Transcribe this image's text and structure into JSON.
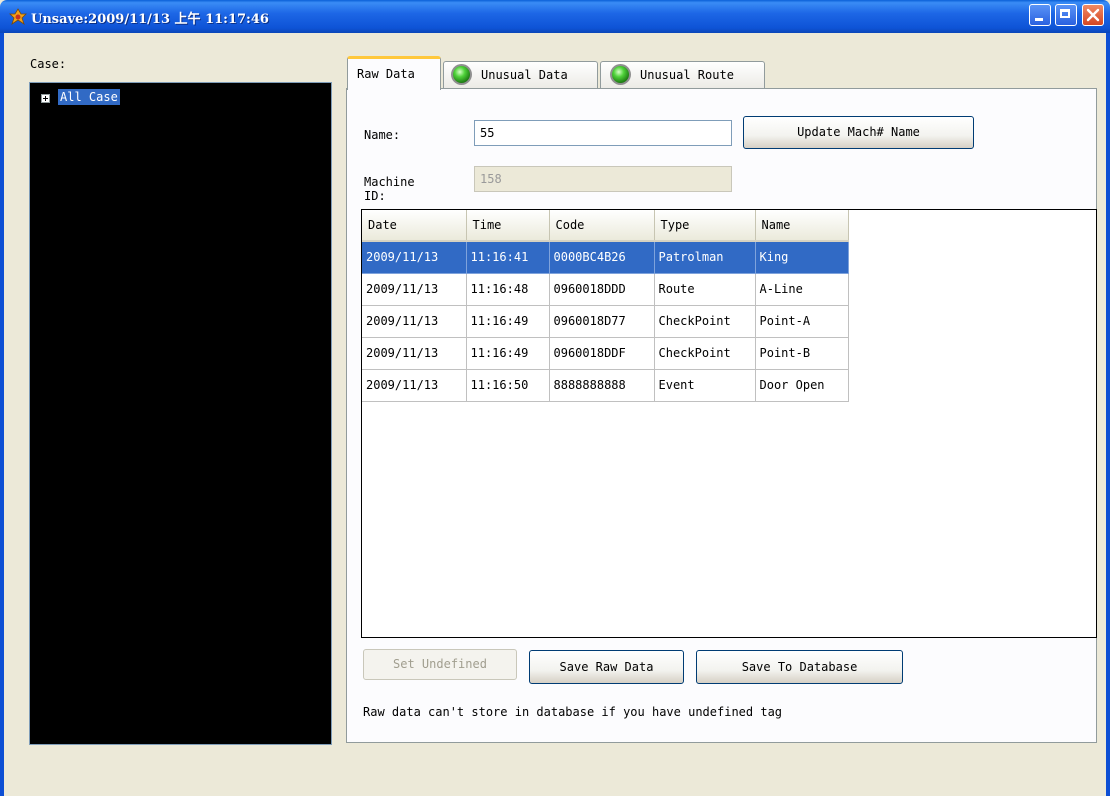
{
  "window": {
    "title": "Unsave:2009/11/13 上午 11:17:46",
    "icon": "app-icon",
    "controls": {
      "minimize": "minimize-icon",
      "maximize": "maximize-icon",
      "close": "close-icon"
    }
  },
  "case_panel": {
    "label": "Case:",
    "tree": {
      "root_label": "All Case",
      "expanded": false
    }
  },
  "tabs": [
    {
      "label": "Raw Data",
      "active": true,
      "indicator": null
    },
    {
      "label": "Unusual Data",
      "active": false,
      "indicator": "green-led-icon"
    },
    {
      "label": "Unusual Route",
      "active": false,
      "indicator": "green-led-icon"
    }
  ],
  "form": {
    "name_label": "Name:",
    "name_value": "55",
    "machine_id_label": "Machine ID:",
    "machine_id_value": "158",
    "update_button": "Update Mach# Name"
  },
  "grid": {
    "columns": [
      "Date",
      "Time",
      "Code",
      "Type",
      "Name"
    ],
    "rows": [
      [
        "2009/11/13",
        "11:16:41",
        "0000BC4B26",
        "Patrolman",
        "King"
      ],
      [
        "2009/11/13",
        "11:16:48",
        "0960018DDD",
        "Route",
        "A-Line"
      ],
      [
        "2009/11/13",
        "11:16:49",
        "0960018D77",
        "CheckPoint",
        "Point-A"
      ],
      [
        "2009/11/13",
        "11:16:49",
        "0960018DDF",
        "CheckPoint",
        "Point-B"
      ],
      [
        "2009/11/13",
        "11:16:50",
        "8888888888",
        "Event",
        "Door Open"
      ]
    ],
    "selected_row": 0
  },
  "actions": {
    "set_undefined": "Set Undefined",
    "save_raw": "Save Raw Data",
    "save_db": "Save To Database"
  },
  "note": "Raw data can't store in database if you have undefined tag",
  "colors": {
    "titlebar": "#0e53d6",
    "selection": "#316ac5",
    "tab_highlight": "#ffc83c",
    "led": "#4fd23a"
  }
}
